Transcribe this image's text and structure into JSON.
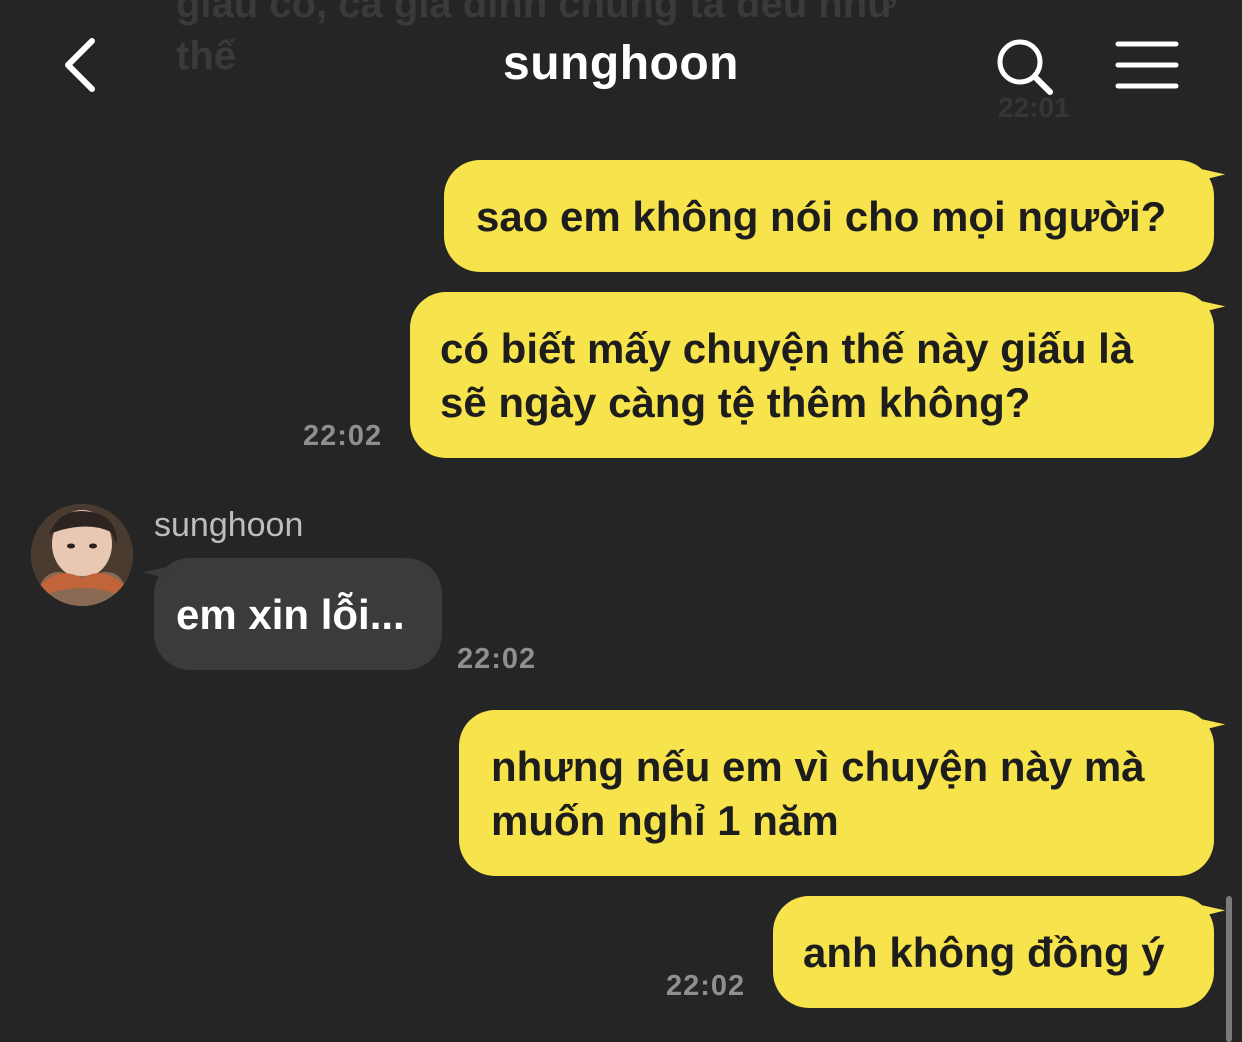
{
  "header": {
    "title": "sunghoon"
  },
  "previous_message": {
    "text": "giấu có, cả gia đình chúng ta đều như thế",
    "time": "22:01"
  },
  "messages": [
    {
      "direction": "sent",
      "text": "sao em không nói cho mọi người?"
    },
    {
      "direction": "sent",
      "text_line1": "có biết mấy chuyện thế này giấu là",
      "text_line2": "sẽ ngày càng tệ thêm không?",
      "time": "22:02"
    },
    {
      "direction": "received",
      "sender": "sunghoon",
      "text": "em xin lỗi...",
      "time": "22:02"
    },
    {
      "direction": "sent",
      "text_line1": "nhưng nếu em vì chuyện này mà",
      "text_line2": "muốn nghỉ 1 năm"
    },
    {
      "direction": "sent",
      "text": "anh không đồng ý",
      "time": "22:02"
    }
  ],
  "colors": {
    "background": "#252525",
    "sent_bubble": "#f7e34b",
    "received_bubble": "#3b3b3b"
  },
  "icons": {
    "back": "chevron-left-icon",
    "search": "search-icon",
    "menu": "hamburger-menu-icon"
  }
}
